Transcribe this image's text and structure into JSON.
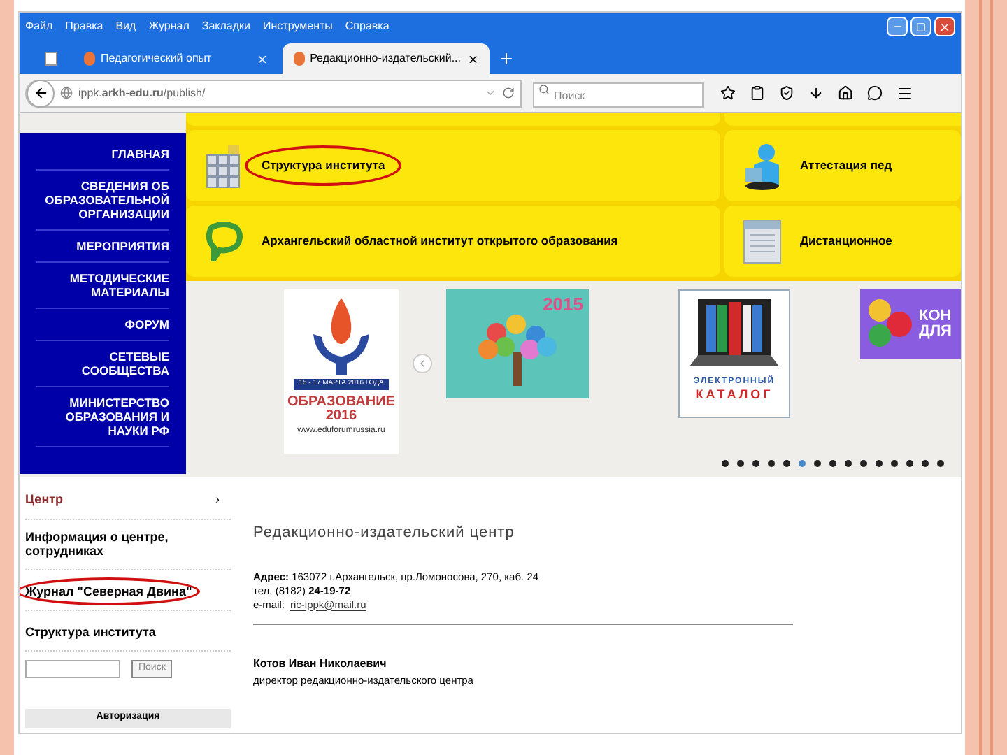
{
  "menu_bar": [
    "Файл",
    "Правка",
    "Вид",
    "Журнал",
    "Закладки",
    "Инструменты",
    "Справка"
  ],
  "tabs": [
    {
      "kind": "pinned",
      "selected": false
    },
    {
      "kind": "tab",
      "label": "Педагогический опыт",
      "selected": false
    },
    {
      "kind": "tab",
      "label": "Редакционно-издательский...",
      "selected": true
    }
  ],
  "address_bar": {
    "url": "ippk.**arkh-edu.ru**/publish/"
  },
  "search_field": {
    "placeholder": "Поиск"
  },
  "nav_menu": [
    "ГЛАВНАЯ",
    "СВЕДЕНИЯ ОБ ОБРАЗОВАТЕЛЬНОЙ ОРГАНИЗАЦИИ",
    "МЕРОПРИЯТИЯ",
    "МЕТОДИЧЕСКИЕ МАТЕРИАЛЫ",
    "ФОРУМ",
    "СЕТЕВЫЕ СООБЩЕСТВА",
    "МИНИСТЕРСТВО ОБРАЗОВАНИЯ И НАУКИ РФ"
  ],
  "tiles": [
    {
      "kind": "blocks",
      "label": "Структура института",
      "highlighted": true
    },
    {
      "kind": "person",
      "label": "Аттестация пед",
      "highlighted": false
    },
    {
      "kind": "speech",
      "label": "Архангельский областной институт открытого образования",
      "highlighted": false
    },
    {
      "kind": "document",
      "label": "Дистанционное",
      "highlighted": false
    }
  ],
  "carousel": {
    "banners": [
      {
        "kind": "forum",
        "texts": [
          "15 - 17 МАРТА 2016 ГОДА",
          "ОБРАЗОВАНИЕ",
          "2016",
          "www.eduforumrussia.ru"
        ]
      },
      {
        "kind": "tree",
        "texts": [
          "2015"
        ]
      },
      {
        "kind": "catalog",
        "texts": [
          "ЭЛЕКТРОННЫЙ",
          "КАТАЛОГ"
        ]
      },
      {
        "kind": "puzzle",
        "texts": [
          "КОН",
          "ДЛЯ"
        ]
      }
    ],
    "dots": [
      {
        "selected": false
      },
      {
        "selected": false
      },
      {
        "selected": false
      },
      {
        "selected": false
      },
      {
        "selected": false
      },
      {
        "selected": true
      },
      {
        "selected": false
      },
      {
        "selected": false
      },
      {
        "selected": false
      },
      {
        "selected": false
      },
      {
        "selected": false
      },
      {
        "selected": false
      },
      {
        "selected": false
      },
      {
        "selected": false
      },
      {
        "selected": false
      }
    ]
  },
  "side_menu": {
    "header": "Центр",
    "arrow": "›",
    "items": [
      {
        "label": "Информация о центре, сотрудниках",
        "highlighted": false
      },
      {
        "label": "Журнал \"Северная Двина\"",
        "highlighted": true
      },
      {
        "label": "Структура института",
        "highlighted": false
      }
    ],
    "search_button": "Поиск",
    "login": "Авторизация"
  },
  "content": {
    "title": "Редакционно-издательский центр",
    "address": "**Адрес:** 163072 г.Архангельск, пр.Ломоносова, 270, каб. 24",
    "phone": "тел. (8182) **24-19-72**",
    "email_label": "e-mail:",
    "email": "ric-ippk@mail.ru",
    "person_name": "Котов Иван Николаевич",
    "person_role": "директор редакционно-издательского центра"
  }
}
